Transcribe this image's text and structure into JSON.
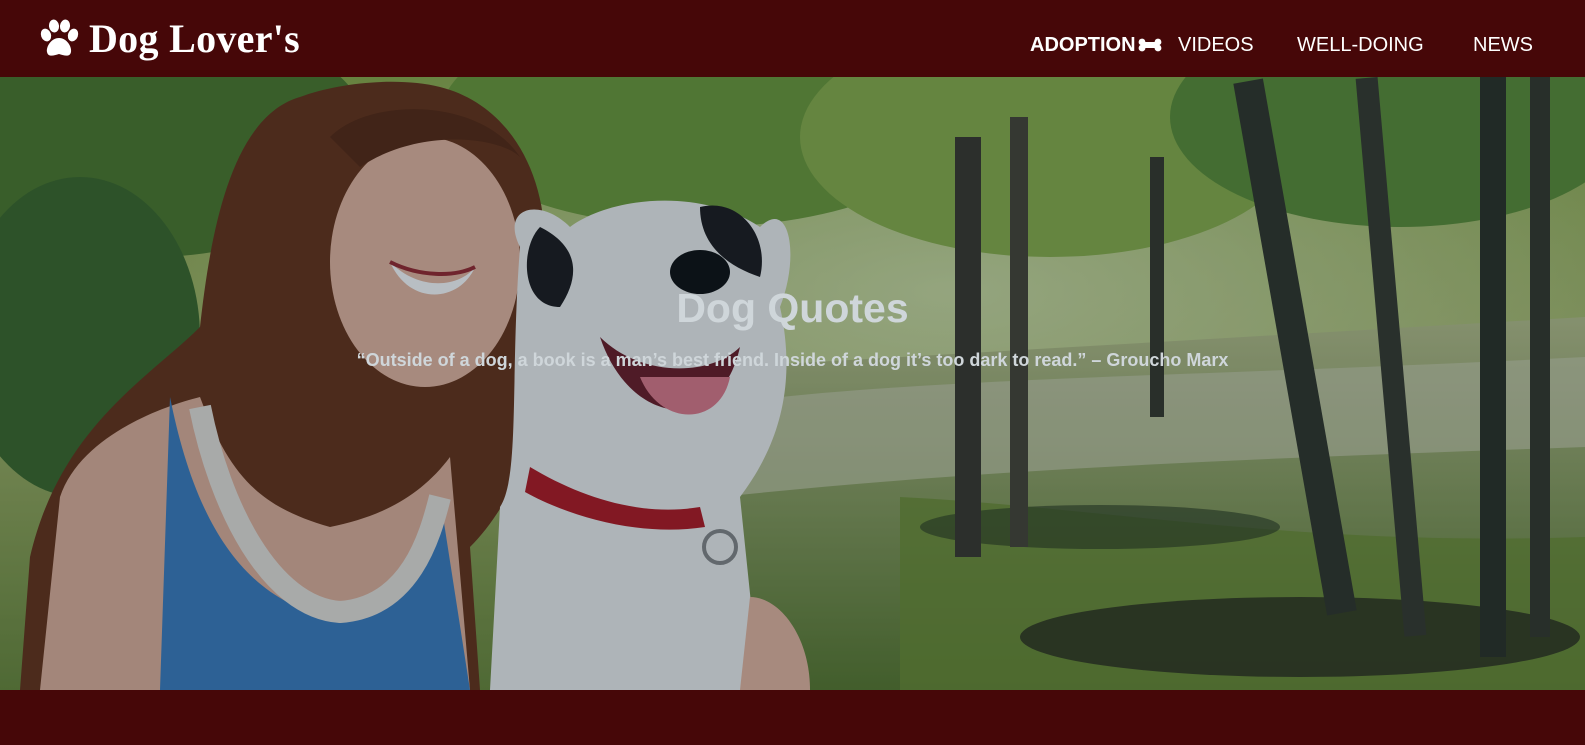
{
  "brand": {
    "name": "Dog Lover's",
    "icon": "paw-icon"
  },
  "nav": {
    "items": [
      {
        "label": "ADOPTION",
        "icon": "bone-icon",
        "active": true
      },
      {
        "label": "VIDEOS"
      },
      {
        "label": "WELL-DOING"
      },
      {
        "label": "NEWS"
      }
    ]
  },
  "hero": {
    "title": "Dog Quotes",
    "quote": "“Outside of a dog, a book is a man’s best friend. Inside of a dog it’s too dark to read.” – Groucho Marx",
    "image": "woman-with-dog-in-park"
  },
  "colors": {
    "brand_bg": "#460708",
    "nav_text": "#ffffff",
    "hero_text": "#cfd6da"
  }
}
